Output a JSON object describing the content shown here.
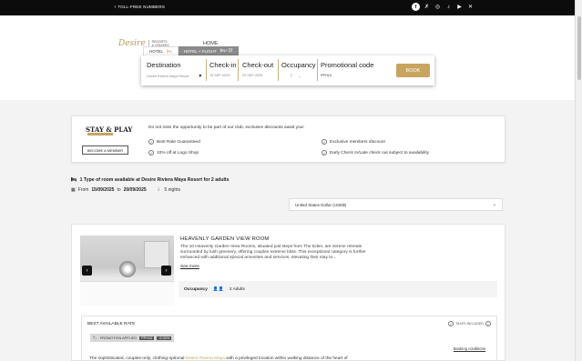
{
  "topbar": {
    "toll_free": "+ TOLL-FREE NUMBERS",
    "social_icons": [
      "facebook-icon",
      "x-twitter-icon",
      "instagram-icon",
      "tiktok-icon",
      "youtube-icon",
      "x-icon"
    ]
  },
  "header": {
    "logo_script": "Desire",
    "logo_sub_line1": "RESORTS",
    "logo_sub_line2": "& CRUISES",
    "nav_home": "HOME"
  },
  "search": {
    "tab_hotel": "HOTEL",
    "tab_hotel_flight": "HOTEL + FLIGHT",
    "destination_label": "Destination",
    "destination_value": "Desire Riviera Maya Resort",
    "checkin_label": "Check-in",
    "checkin_value": "15 SEP 2025",
    "checkout_label": "Check-out",
    "checkout_value": "20 SEP 2025",
    "occupancy_label": "Occupancy",
    "occupancy_value": "2",
    "promo_label": "Promotional code",
    "promo_value": "PPH10",
    "book_button": "BOOK"
  },
  "club": {
    "logo_text": "STAY & PLAY",
    "become_member": "BECOME A MEMBER",
    "promo_text": "Do not miss the opportunity to be part of our club, exclusive discounts await you!",
    "benefits": [
      "Best Rate Guaranteed",
      "Exclusive members discount",
      "10% off at Logo Shop",
      "Early Check In/Late check out subject to availability"
    ]
  },
  "availability": {
    "summary": "1 Type of room available at Desire Riviera Maya Resort for 2 adults",
    "from_label": "From",
    "from_date": "15/09/2025",
    "to_label": "to",
    "to_date": "20/09/2025",
    "nights": "5 nights"
  },
  "currency": {
    "selected": "United States Dollar (USD$)"
  },
  "room": {
    "title": "HEAVENLY GARDEN VIEW ROOM",
    "description": "The 10 Heavenly Garden-View Rooms, situated just steps from The Eden, are serene retreats surrounded by lush greenery, offering couples extreme bliss. This exceptional category is further enhanced with additional special amenities and services, elevating their stay to...",
    "see_more": "See more",
    "occupancy_label": "Occupancy",
    "occupancy_value": "2 Adults"
  },
  "rate": {
    "title": "BEST AVAILABLE RATE",
    "taxes": "TAXES INCLUDED",
    "promo_applied": "PROMOTION APPLIED",
    "promo_code": "PPH10",
    "promo_discount": "-5.00%",
    "booking_conditions": "Booking conditions",
    "description_start": "The sophisticated, couples-only, clothing-optional ",
    "description_link": "Desire Riviera Maya",
    "description_end": " with a privileged location within walking distance of the heart of"
  },
  "colors": {
    "gold": "#c8a461",
    "topbar": "#0c0c0c"
  }
}
